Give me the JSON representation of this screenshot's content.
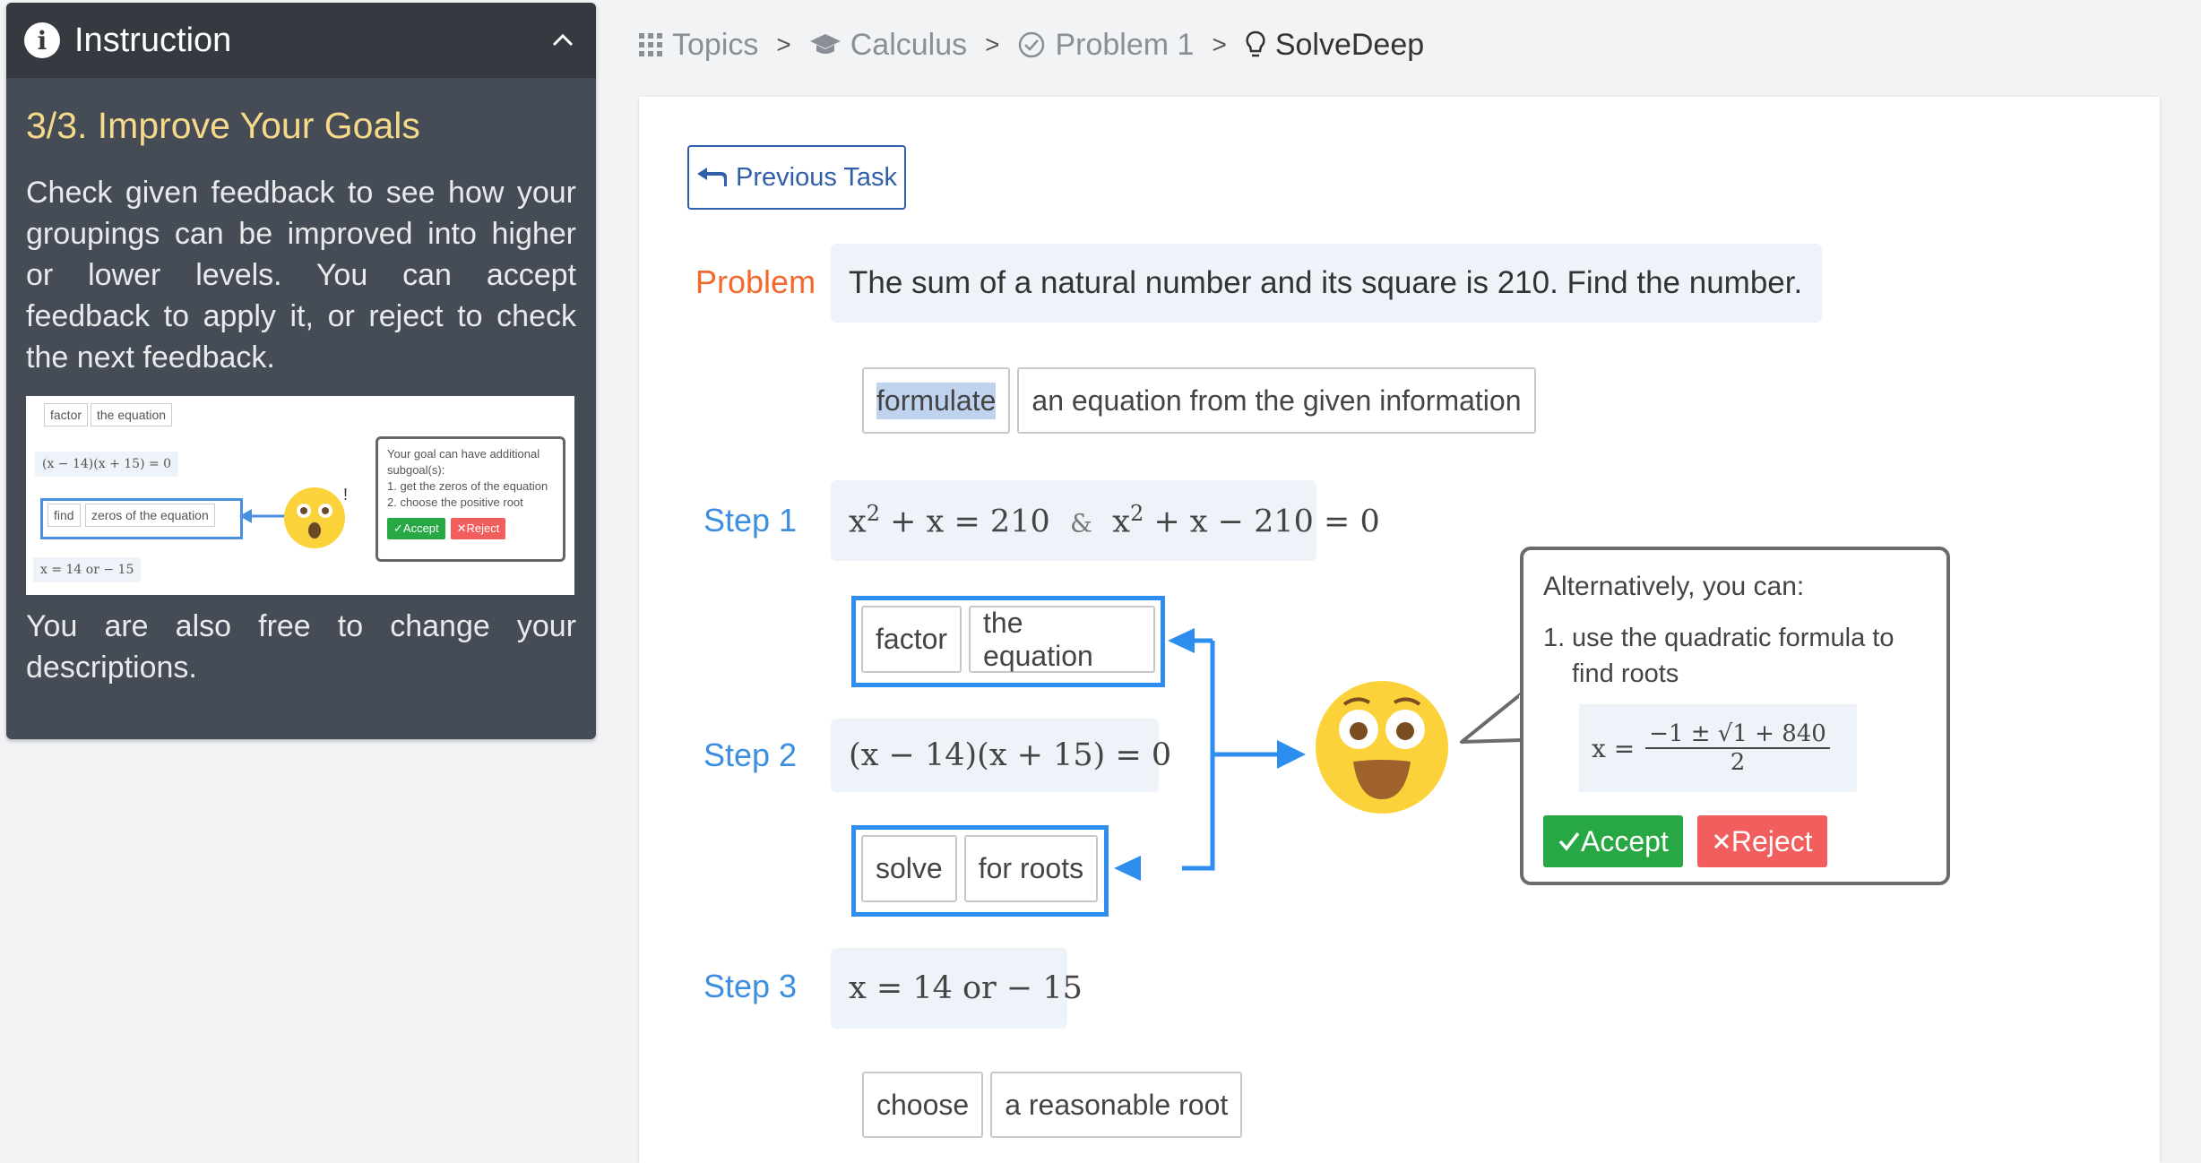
{
  "instruction": {
    "header_title": "Instruction",
    "subtitle": "3/3. Improve Your Goals",
    "text1": "Check given feedback to see how your groupings can be improved into higher or lower levels. You can accept feedback to apply it, or reject to check the next feedback.",
    "text2": "You are also free to change your descriptions.",
    "thumbnail": {
      "goal1": [
        "factor",
        "the equation"
      ],
      "math1": "(x − 14)(x + 15) = 0",
      "goal2": [
        "find",
        "zeros of the equation"
      ],
      "math2": "x = 14 or − 15",
      "bubble_line1": "Your goal can have additional subgoal(s):",
      "bubble_item1": "1. get the zeros of the equation",
      "bubble_item2": "2. choose the positive root",
      "accept": "✓Accept",
      "reject": "✕Reject"
    }
  },
  "breadcrumb": {
    "items": [
      "Topics",
      "Calculus",
      "Problem 1"
    ],
    "current": "SolveDeep",
    "separator": ">"
  },
  "main": {
    "prev_button": "Previous Task",
    "problem_label": "Problem",
    "problem_text": "The sum of a natural number and its square is 210. Find the number.",
    "goal0": {
      "verb": "formulate",
      "object": "an equation from the given information"
    },
    "step1": {
      "label": "Step 1",
      "math_a": "x",
      "sup_a": "2",
      "rest_a": " + x = 210",
      "amp": "&",
      "math_b": "x",
      "sup_b": "2",
      "rest_b": " + x − 210 = 0"
    },
    "goal1": {
      "verb": "factor",
      "object": "the equation"
    },
    "step2": {
      "label": "Step 2",
      "math": "(x − 14)(x + 15) = 0"
    },
    "goal2": {
      "verb": "solve",
      "object": "for roots"
    },
    "step3": {
      "label": "Step 3",
      "math": "x = 14 or − 15"
    },
    "goal3": {
      "verb": "choose",
      "object": "a reasonable root"
    }
  },
  "feedback": {
    "title": "Alternatively, you can:",
    "item_num": "1.",
    "item_text": "use the quadratic formula to find roots",
    "formula_lhs": "x =",
    "formula_num": "−1 ± √1 + 840",
    "formula_den": "2",
    "accept": "Accept",
    "reject": "Reject"
  },
  "colors": {
    "panel_bg": "#454c55",
    "panel_header": "#353a41",
    "subtitle": "#f7d98a",
    "problem_label": "#f06a2c",
    "step_label": "#3c8fe0",
    "selection": "#2e8ef0",
    "accept": "#28a745",
    "reject": "#f25d5d"
  },
  "icons": [
    "info-icon",
    "chevron-up-icon",
    "grid-icon",
    "graduation-cap-icon",
    "check-circle-icon",
    "lightbulb-icon",
    "undo-icon",
    "surprised-face-icon",
    "check-icon",
    "close-icon"
  ]
}
